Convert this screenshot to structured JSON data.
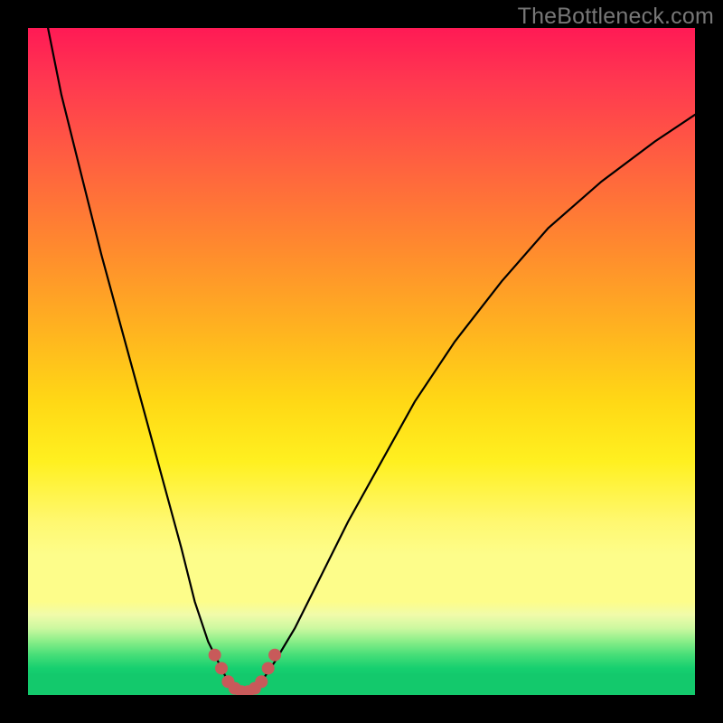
{
  "watermark": "TheBottleneck.com",
  "colors": {
    "frame": "#000000",
    "gradient_top": "#ff1a55",
    "gradient_mid": "#ffe030",
    "gradient_bottom": "#13c96c",
    "curve": "#000000",
    "marker": "#c85a5a",
    "watermark_text": "#777777"
  },
  "chart_data": {
    "type": "line",
    "title": "",
    "xlabel": "",
    "ylabel": "",
    "xlim": [
      0,
      100
    ],
    "ylim": [
      0,
      100
    ],
    "series": [
      {
        "name": "bottleneck-curve",
        "x": [
          3,
          5,
          8,
          11,
          14,
          17,
          20,
          23,
          25,
          27,
          29,
          30,
          31,
          32,
          33,
          34,
          35,
          37,
          40,
          44,
          48,
          53,
          58,
          64,
          71,
          78,
          86,
          94,
          100
        ],
        "y": [
          100,
          90,
          78,
          66,
          55,
          44,
          33,
          22,
          14,
          8,
          4,
          2,
          1,
          0.5,
          0.5,
          1,
          2,
          5,
          10,
          18,
          26,
          35,
          44,
          53,
          62,
          70,
          77,
          83,
          87
        ]
      }
    ],
    "markers": {
      "name": "optimal-region",
      "x": [
        28,
        29,
        30,
        31,
        32,
        33,
        34,
        35,
        36,
        37
      ],
      "y": [
        6,
        4,
        2,
        1,
        0.5,
        0.5,
        1,
        2,
        4,
        6
      ]
    },
    "notes": "x and y are relative percentages of the 738×738 plot area (0 = left/bottom edge, 100 = right/top edge). Axes are unlabeled in the source image."
  }
}
